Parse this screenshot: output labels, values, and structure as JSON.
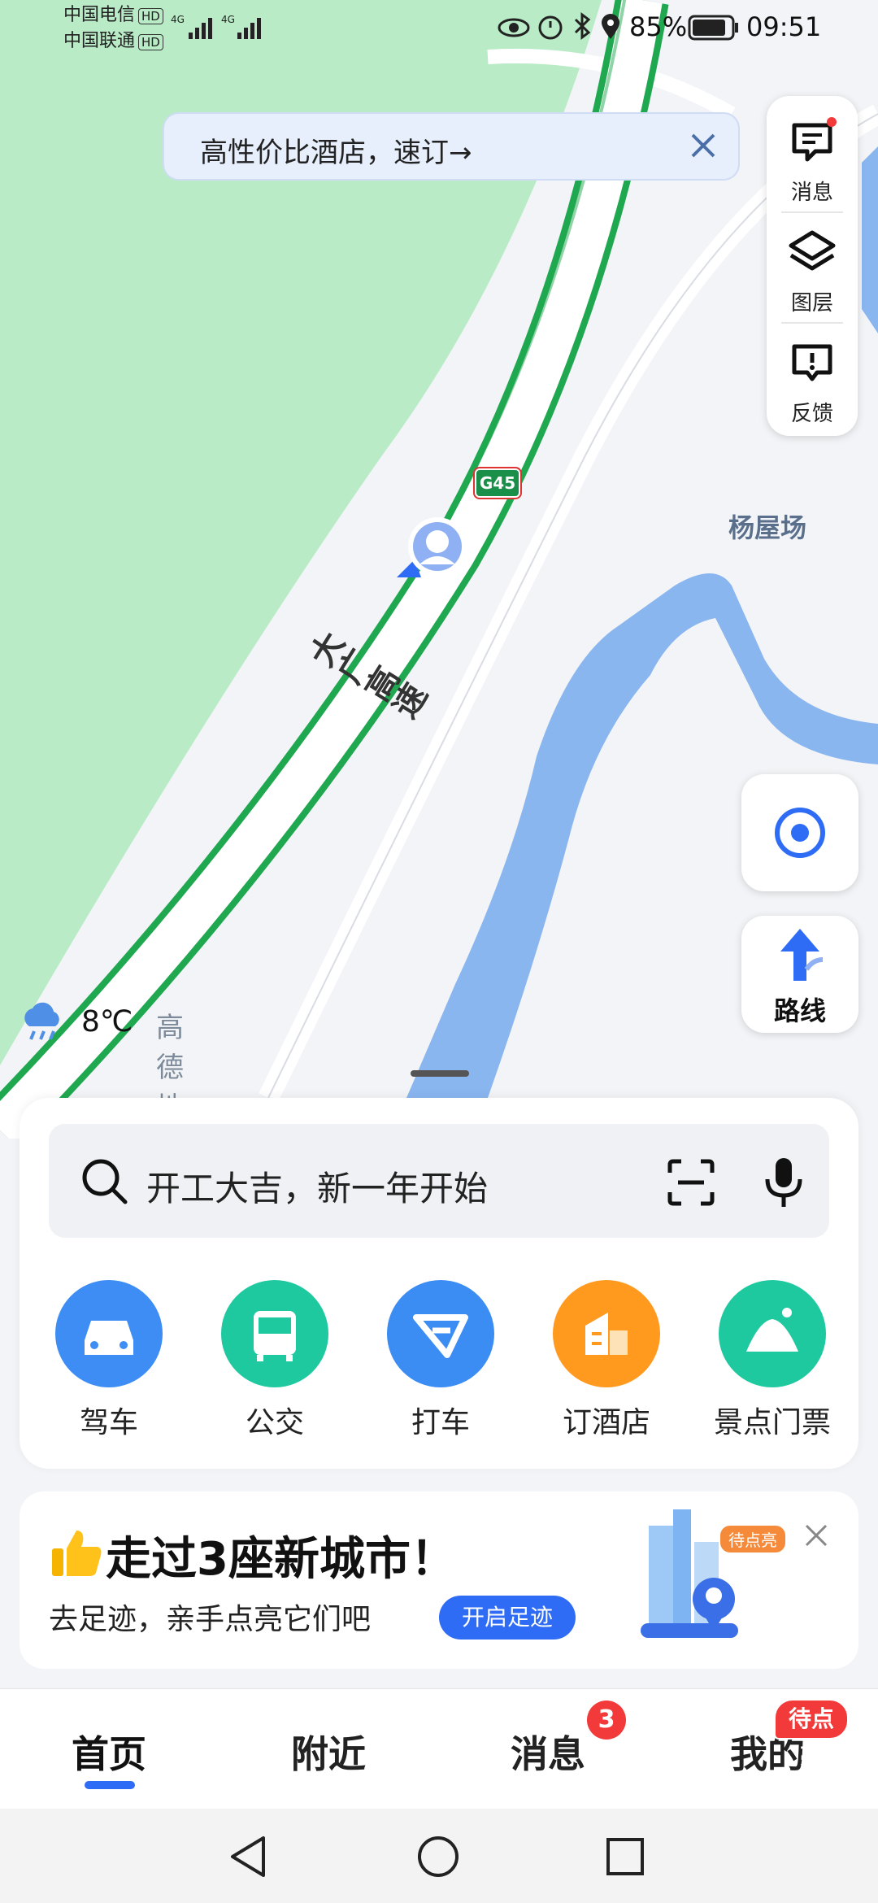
{
  "status_bar": {
    "carrier1": "中国电信",
    "carrier2": "中国联通",
    "hd": "HD",
    "net1": "4G",
    "net2": "4G",
    "battery": "85%",
    "time": "09:51"
  },
  "promo": {
    "text": "高性价比酒店，速订→"
  },
  "tools": [
    {
      "label": "消息",
      "icon": "message-icon",
      "has_dot": true
    },
    {
      "label": "图层",
      "icon": "layers-icon"
    },
    {
      "label": "反馈",
      "icon": "feedback-icon"
    }
  ],
  "map": {
    "road_name": "大广高速",
    "shield": "G45",
    "place": "杨屋场",
    "colors": {
      "green": "#b9ebc6",
      "water": "#8ab6f0",
      "road_edge": "#1fa84f"
    }
  },
  "route_button": {
    "label": "路线"
  },
  "weather": {
    "temperature": "8℃",
    "brand": "高德地图"
  },
  "search": {
    "placeholder": "开工大吉，新一年开始"
  },
  "quick_actions": [
    {
      "label": "驾车",
      "icon": "car-icon",
      "color": "#3d8df5"
    },
    {
      "label": "公交",
      "icon": "bus-icon",
      "color": "#1fc9a0"
    },
    {
      "label": "打车",
      "icon": "taxi-icon",
      "color": "#3b8cf3"
    },
    {
      "label": "订酒店",
      "icon": "hotel-icon",
      "color": "#ff9a1f"
    },
    {
      "label": "景点门票",
      "icon": "scenic-icon",
      "color": "#1fc9a0"
    }
  ],
  "footprint": {
    "title": "走过3座新城市！",
    "subtitle": "去足迹，亲手点亮它们吧",
    "button": "开启足迹",
    "tag": "待点亮"
  },
  "tabs": [
    {
      "label": "首页",
      "active": true
    },
    {
      "label": "附近"
    },
    {
      "label": "消息",
      "badge": "3"
    },
    {
      "label": "我的",
      "badge": "待点亮"
    }
  ],
  "accent": "#2f6cf6"
}
